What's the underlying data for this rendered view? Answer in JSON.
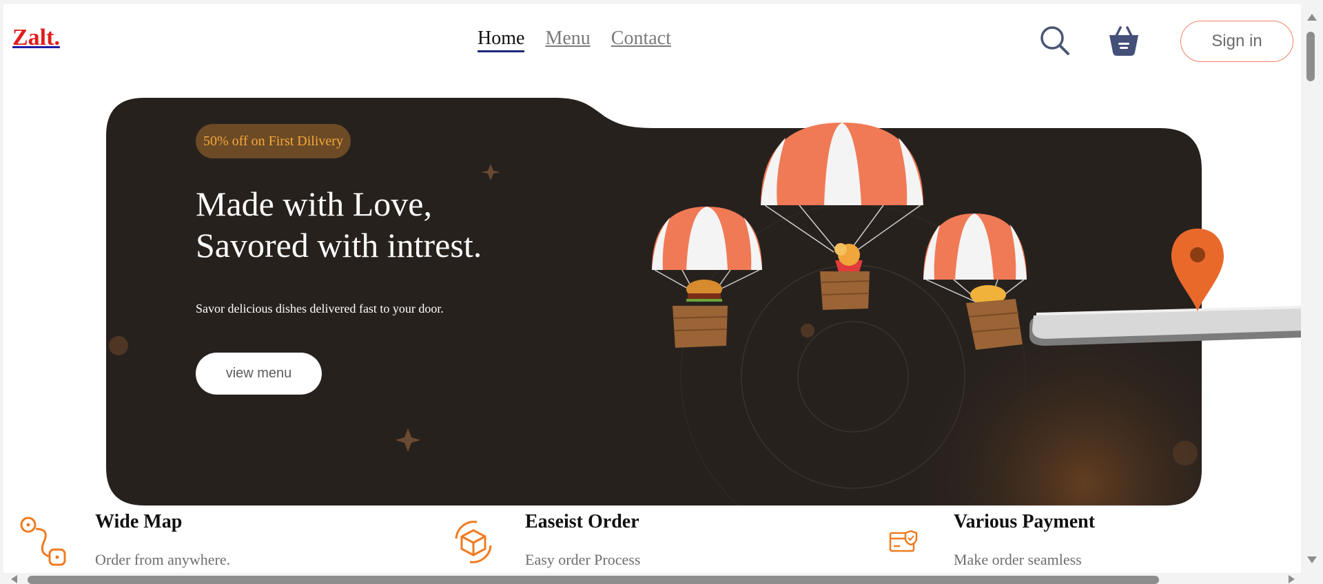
{
  "header": {
    "logo": "Zalt.",
    "nav": [
      "Home",
      "Menu",
      "Contact"
    ],
    "active_nav": "Home",
    "sign_in_label": "Sign in",
    "icons": [
      "search-icon",
      "basket-icon"
    ]
  },
  "hero": {
    "badge": "50% off on First Dilivery",
    "headline_line1": "Made with Love,",
    "headline_line2": "Savored with intrest.",
    "subtext": "Savor delicious dishes delivered fast to your door.",
    "cta_label": "view menu"
  },
  "features": [
    {
      "title": "Wide Map",
      "description": "Order from anywhere.",
      "icon": "route-map-icon"
    },
    {
      "title": "Easeist Order",
      "description": "Easy order Process",
      "icon": "package-cycle-icon"
    },
    {
      "title": "Various Payment",
      "description": "Make order seamless",
      "icon": "secure-card-icon"
    }
  ],
  "colors": {
    "accent": "#f07a3a",
    "logo": "#e11d1d",
    "hero_bg": "#27211e",
    "badge_bg": "#6b4a25",
    "badge_text": "#f6a93a",
    "signin_border": "#f08364"
  }
}
